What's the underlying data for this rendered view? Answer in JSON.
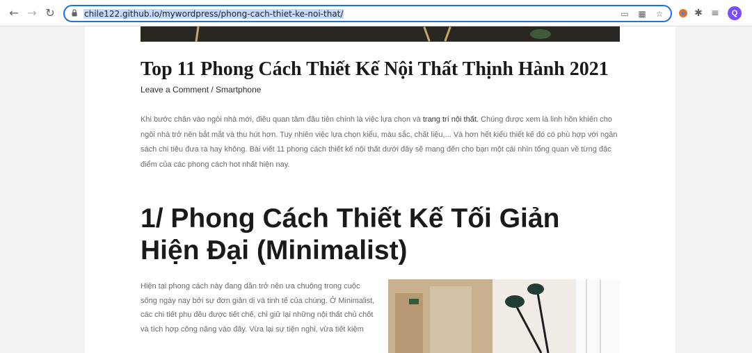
{
  "browser": {
    "url": "chile122.github.io/mywordpress/phong-cach-thiet-ke-noi-that/",
    "profile_initial": "Q",
    "accent": "#1a73e8"
  },
  "article": {
    "title": "Top 11 Phong Cách Thiết Kế Nội Thất Thịnh Hành 2021",
    "meta": "Leave a Comment / Smartphone",
    "intro_before": "Khi bước chân vào ngôi nhà mới, điều quan tâm đầu tiên chính là việc lựa chọn và ",
    "intro_highlight": "trang trí nội thất",
    "intro_after": ". Chúng được xem là linh hồn khiến cho ngôi nhà trở nên bắt mắt và thu hút hơn. Tuy nhiên việc lựa chọn kiểu, màu sắc, chất liệu,... Và hơn hết kiểu thiết kế đó có phù hợp với ngân sách chi tiêu đưa ra hay không. Bài viết 11 phong cách thiết kế nội thất dưới đây sẽ mang đến cho bạn một cái nhìn tổng quan về từng đặc điểm của các phong cách hot nhất hiện nay.",
    "section1_heading": "1/ Phong Cách Thiết Kế Tối Giản Hiện Đại (Minimalist)",
    "section1_text": "Hiện tại phong cách này đang dần trở nên ưa chuộng trong cuộc sống ngày nay bởi sự đơn giản dị và tinh tế của chúng. Ở Minimalist, các chi tiết phụ đều được tiết chế, chỉ giữ lại những nội thất chủ chốt và tích hợp công năng vào đây. Vừa lại sự tiện nghi, vừa tiết kiệm"
  }
}
